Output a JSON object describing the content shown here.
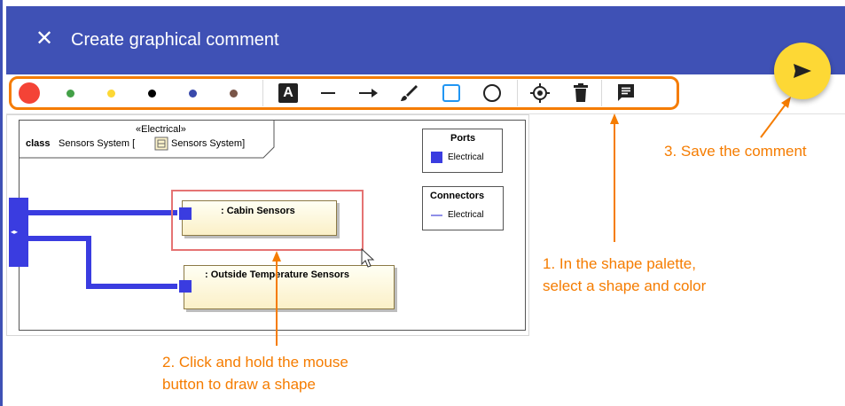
{
  "header": {
    "title": "Create graphical comment",
    "close_icon": "close-icon",
    "send_icon": "send-icon"
  },
  "toolbar": {
    "colors": [
      {
        "name": "red",
        "hex": "#f44336",
        "selected": true
      },
      {
        "name": "green",
        "hex": "#43a047"
      },
      {
        "name": "yellow",
        "hex": "#fdd835"
      },
      {
        "name": "black",
        "hex": "#000000"
      },
      {
        "name": "blue",
        "hex": "#3949ab"
      },
      {
        "name": "brown",
        "hex": "#795548"
      }
    ],
    "tools": [
      {
        "name": "text-tool",
        "icon": "text-icon",
        "glyph": "A"
      },
      {
        "name": "line-tool",
        "icon": "line-icon"
      },
      {
        "name": "arrow-tool",
        "icon": "arrow-icon"
      },
      {
        "name": "brush-tool",
        "icon": "brush-icon"
      },
      {
        "name": "rectangle-tool",
        "icon": "rectangle-icon",
        "selected": true
      },
      {
        "name": "ellipse-tool",
        "icon": "ellipse-icon"
      },
      {
        "name": "target-tool",
        "icon": "target-icon"
      },
      {
        "name": "delete-tool",
        "icon": "trash-icon"
      },
      {
        "name": "comment-tool",
        "icon": "comment-icon"
      }
    ],
    "highlight_color": "#f57c00"
  },
  "diagram": {
    "stereotype": "«Electrical»",
    "class_keyword": "class",
    "class_name": "Sensors System [",
    "class_type": "Sensors System]",
    "legend_ports": {
      "title": "Ports",
      "item": "Electrical",
      "color": "#3a3ce0"
    },
    "legend_connectors": {
      "title": "Connectors",
      "item": "Electrical",
      "color": "#8f8fe8"
    },
    "parts": [
      {
        "label": ": Cabin Sensors"
      },
      {
        "label": ": Outside Temperature Sensors"
      }
    ],
    "selection_color": "#e57373",
    "wire_color": "#3a3ce0"
  },
  "annotations": {
    "step1_line1": "1. In the shape palette,",
    "step1_line2": "select a shape and color",
    "step2_line1": "2. Click and hold the mouse",
    "step2_line2": "button to draw a shape",
    "step3": "3. Save the comment",
    "color": "#f57c00"
  }
}
